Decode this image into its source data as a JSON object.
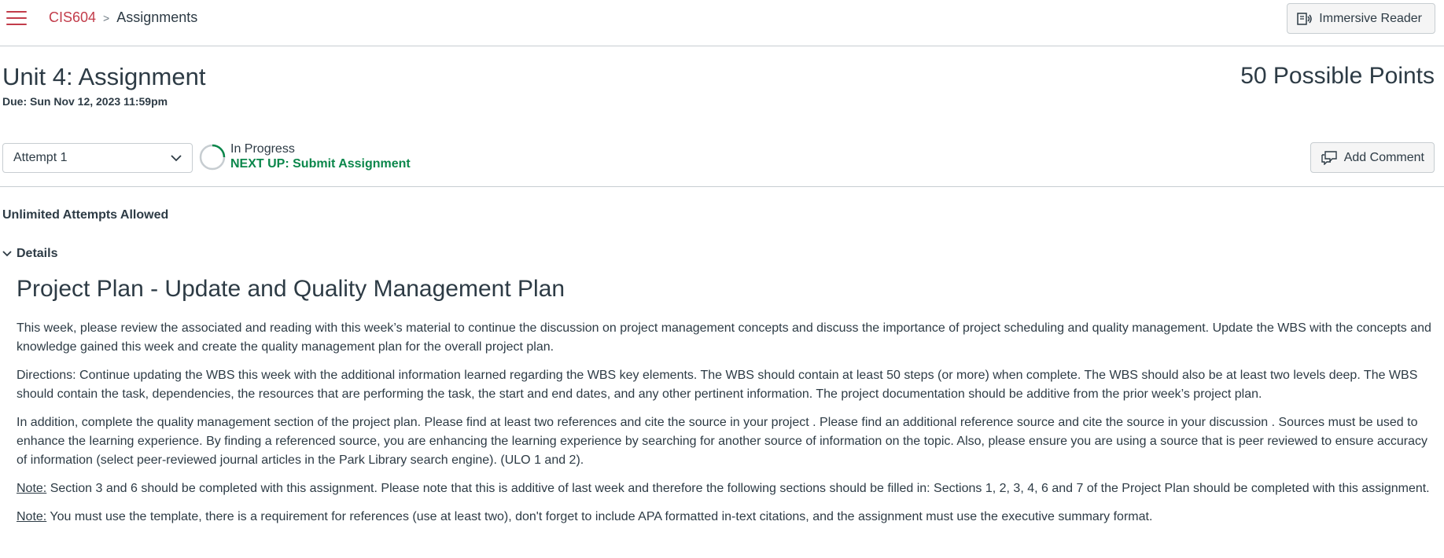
{
  "topbar": {
    "course": "CIS604",
    "separator": ">",
    "current": "Assignments",
    "immersive_reader": "Immersive Reader"
  },
  "header": {
    "title": "Unit 4: Assignment",
    "due": "Due: Sun Nov 12, 2023 11:59pm",
    "points": "50 Possible Points"
  },
  "attempt": {
    "selected": "Attempt 1",
    "status": "In Progress",
    "next_up": "NEXT UP: Submit Assignment",
    "add_comment": "Add Comment"
  },
  "attempts_allowed": "Unlimited Attempts Allowed",
  "details": {
    "label": "Details",
    "heading": "Project Plan - Update and Quality Management Plan",
    "p1": "This week, please review the associated and reading with this week’s material to continue the discussion on project management concepts and discuss the importance of project scheduling and quality management.  Update the WBS with the concepts and knowledge gained this week and create the quality management plan for the overall project plan.",
    "p2": "Directions: Continue updating the WBS this week with the additional information learned regarding the WBS key elements. The WBS should contain at least 50 steps (or more) when complete.  The WBS should also be at least two levels deep.  The WBS should contain the task, dependencies, the resources that are performing the task, the start and end dates, and any other pertinent information.  The project documentation should be additive from the prior week’s project plan.",
    "p3": "In addition, complete the quality management section of the project plan. Please find at least two references and cite the source in your project .  Please find an additional reference source and cite the source in your discussion  . Sources must be used to enhance the learning experience.  By finding a referenced source, you are enhancing the learning experience by searching for another source of information on the topic.  Also, please ensure you are using a source that is peer reviewed to ensure accuracy of information (select peer-reviewed journal articles in the Park Library search engine).  (ULO 1 and 2).",
    "note_label": "Note:",
    "note1": " Section 3 and 6 should be completed with this assignment. Please note that this is additive of last week and therefore the following sections should be filled in: Sections 1, 2, 3, 4, 6 and 7 of the Project Plan should be completed with this assignment.",
    "note2": " You must use the template, there is a requirement for references (use at least two), don't forget to include APA formatted in-text citations, and the assignment must use the executive summary format."
  },
  "colors": {
    "accent": "#c23c4a",
    "success": "#0b874b",
    "text": "#2d3b45",
    "border": "#c7cdd1"
  },
  "icons": {
    "menu": "hamburger-icon",
    "reader": "immersive-reader-icon",
    "dropdown": "chevron-down-icon",
    "progress": "progress-ring-icon",
    "comment": "comment-icon",
    "details": "chevron-down-icon"
  }
}
